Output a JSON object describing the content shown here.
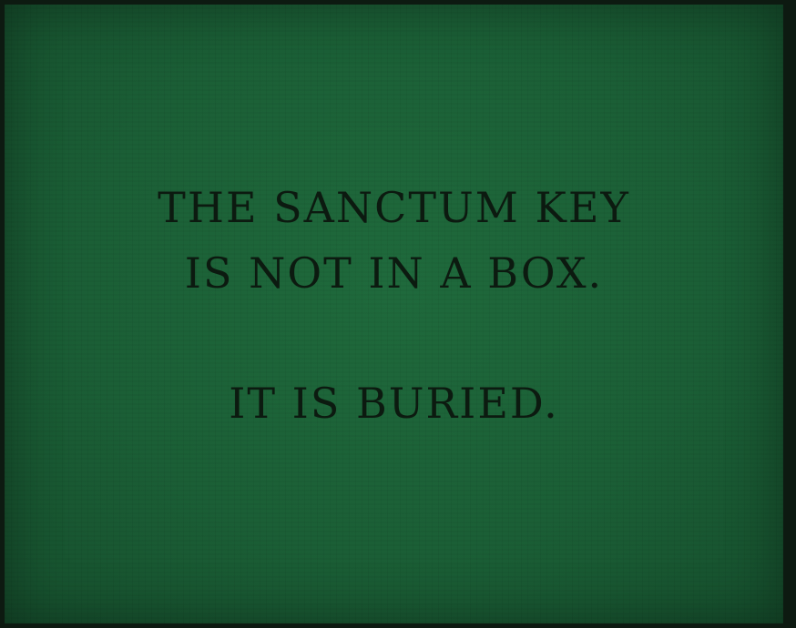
{
  "message": {
    "lines": [
      "THE SANCTUM KEY",
      "IS NOT IN A BOX.",
      "IT IS BURIED."
    ]
  },
  "colors": {
    "background": "#1b5f36",
    "text": "#0c1a10",
    "border": "#0d1a11"
  }
}
